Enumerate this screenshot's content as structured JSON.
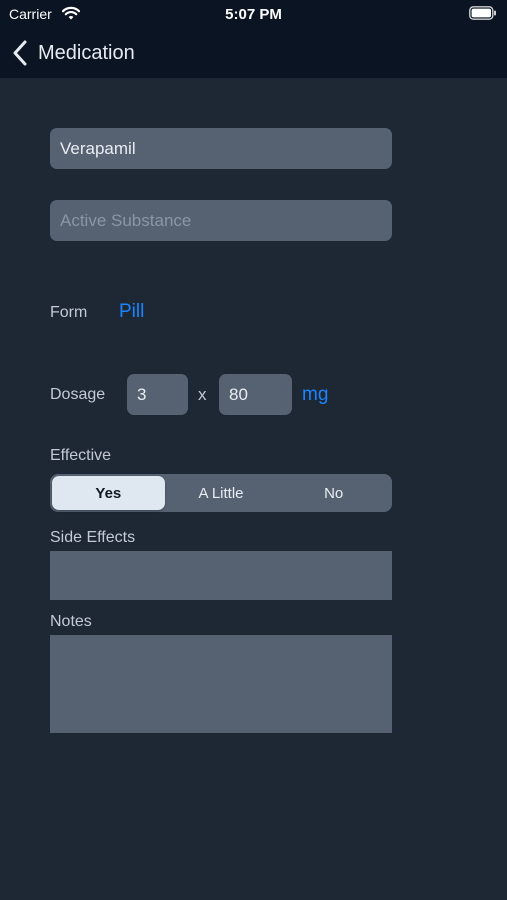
{
  "status_bar": {
    "carrier": "Carrier",
    "time": "5:07 PM"
  },
  "nav": {
    "back_icon": "chevron-left",
    "title": "Medication"
  },
  "form": {
    "name": {
      "value": "Verapamil"
    },
    "active_substance": {
      "value": "",
      "placeholder": "Active Substance"
    },
    "form_row": {
      "label": "Form",
      "value": "Pill"
    },
    "dosage": {
      "label": "Dosage",
      "count": "3",
      "times": "x",
      "amount": "80",
      "unit": "mg"
    },
    "effective": {
      "label": "Effective",
      "options": [
        "Yes",
        "A Little",
        "No"
      ],
      "selected": "Yes"
    },
    "side_effects": {
      "label": "Side Effects",
      "value": ""
    },
    "notes": {
      "label": "Notes",
      "value": ""
    }
  },
  "colors": {
    "background": "#1e2734",
    "nav_background": "#0b1422",
    "field": "#566272",
    "accent": "#1a85ff",
    "segment_selected": "#dfe7f1"
  }
}
